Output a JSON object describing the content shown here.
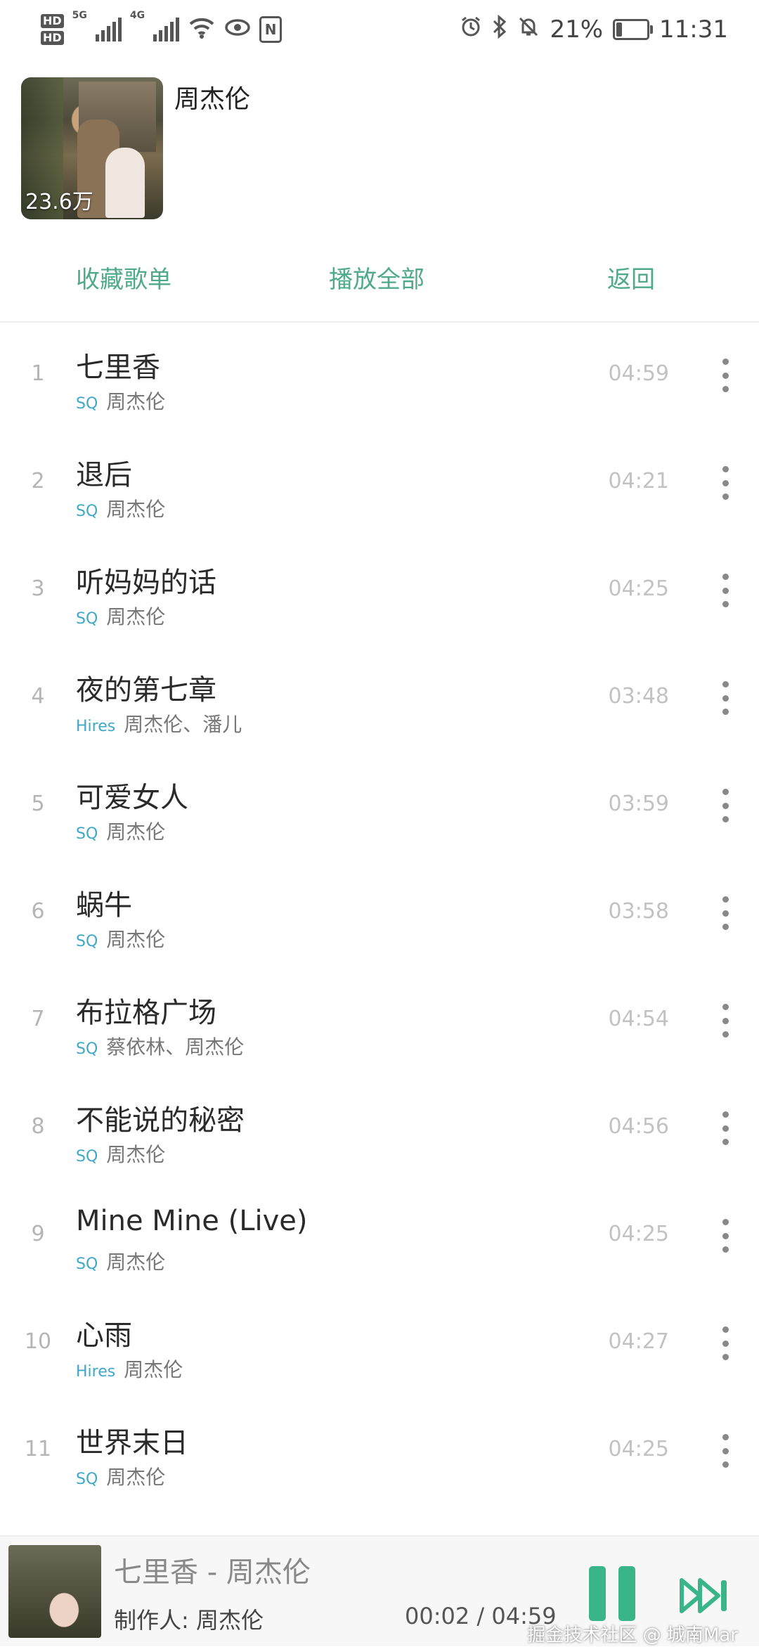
{
  "status_bar": {
    "hd_top": "HD",
    "hd_bottom": "HD",
    "network": "5G",
    "network2": "4G",
    "icons": [
      "signal-icon",
      "wifi-icon",
      "eye-icon",
      "nfc-icon",
      "alarm-icon",
      "bluetooth-icon",
      "mute-icon"
    ],
    "battery": "21%",
    "battery_level": 0.21,
    "time": "11:31"
  },
  "album": {
    "artist": "周杰伦",
    "play_count": "23.6万"
  },
  "actions": {
    "collect": "收藏歌单",
    "play_all": "播放全部",
    "back": "返回"
  },
  "colors": {
    "accent": "#4fa98b",
    "quality": "#3fa8c8",
    "play_button": "#3ab58a"
  },
  "songs": [
    {
      "num": "1",
      "title": "七里香",
      "quality": "SQ",
      "artist": "周杰伦",
      "duration": "04:59"
    },
    {
      "num": "2",
      "title": "退后",
      "quality": "SQ",
      "artist": "周杰伦",
      "duration": "04:21"
    },
    {
      "num": "3",
      "title": "听妈妈的话",
      "quality": "SQ",
      "artist": "周杰伦",
      "duration": "04:25"
    },
    {
      "num": "4",
      "title": "夜的第七章",
      "quality": "Hires",
      "artist": "周杰伦、潘儿",
      "duration": "03:48"
    },
    {
      "num": "5",
      "title": "可爱女人",
      "quality": "SQ",
      "artist": "周杰伦",
      "duration": "03:59"
    },
    {
      "num": "6",
      "title": "蜗牛",
      "quality": "SQ",
      "artist": "周杰伦",
      "duration": "03:58"
    },
    {
      "num": "7",
      "title": "布拉格广场",
      "quality": "SQ",
      "artist": "蔡依林、周杰伦",
      "duration": "04:54"
    },
    {
      "num": "8",
      "title": "不能说的秘密",
      "quality": "SQ",
      "artist": "周杰伦",
      "duration": "04:56"
    },
    {
      "num": "9",
      "title": "Mine Mine (Live)",
      "quality": "SQ",
      "artist": "周杰伦",
      "duration": "04:25"
    },
    {
      "num": "10",
      "title": "心雨",
      "quality": "Hires",
      "artist": "周杰伦",
      "duration": "04:27"
    },
    {
      "num": "11",
      "title": "世界末日",
      "quality": "SQ",
      "artist": "周杰伦",
      "duration": "04:25"
    }
  ],
  "player": {
    "title": "七里香 - 周杰伦",
    "maker": "制作人: 周杰伦",
    "time": "00:02 / 04:59"
  },
  "watermark": "掘金技术社区 @ 城南Mar"
}
